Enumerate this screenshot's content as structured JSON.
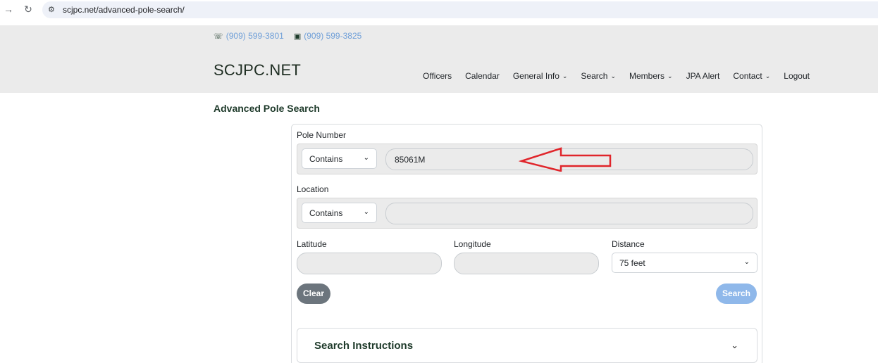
{
  "browser": {
    "back_icon": "arrow-right-icon",
    "reload_icon": "reload-icon",
    "site_info_icon": "tune-icon",
    "url": "scjpc.net/advanced-pole-search/"
  },
  "header": {
    "phone": "(909) 599-3801",
    "fax": "(909) 599-3825",
    "brand": "SCJPC.NET",
    "nav": [
      {
        "label": "Officers",
        "dropdown": false
      },
      {
        "label": "Calendar",
        "dropdown": false
      },
      {
        "label": "General Info",
        "dropdown": true
      },
      {
        "label": "Search",
        "dropdown": true
      },
      {
        "label": "Members",
        "dropdown": true
      },
      {
        "label": "JPA Alert",
        "dropdown": false
      },
      {
        "label": "Contact",
        "dropdown": true
      },
      {
        "label": "Logout",
        "dropdown": false
      }
    ]
  },
  "page": {
    "title": "Advanced Pole Search"
  },
  "form": {
    "pole_number": {
      "label": "Pole Number",
      "match": "Contains",
      "value": "85061M"
    },
    "location": {
      "label": "Location",
      "match": "Contains",
      "value": ""
    },
    "latitude": {
      "label": "Latitude",
      "value": ""
    },
    "longitude": {
      "label": "Longitude",
      "value": ""
    },
    "distance": {
      "label": "Distance",
      "value": "75 feet"
    },
    "clear_label": "Clear",
    "search_label": "Search",
    "instructions_label": "Search Instructions"
  },
  "colors": {
    "annotation_arrow": "#e0252b",
    "search_button": "#8fb8ea",
    "clear_button": "#6c757d",
    "header_bg": "#ebebeb"
  }
}
